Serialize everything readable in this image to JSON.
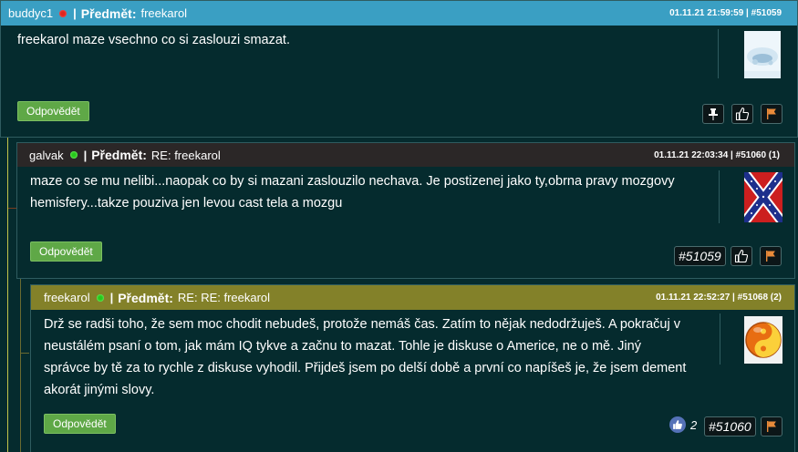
{
  "posts": [
    {
      "author": "buddyc1",
      "status_color": "#e0261e",
      "separator": "|",
      "subject_label": "Předmět:",
      "subject": "freekarol",
      "meta": "01.11.21 21:59:59 | #51059",
      "body": "freekarol maze vsechno co si zaslouzi smazat.",
      "reply_label": "Odpovědět",
      "header_color": "#3a9fc3"
    },
    {
      "author": "galvak",
      "status_color": "#26c91a",
      "separator": "|",
      "subject_label": "Předmět:",
      "subject": "RE: freekarol",
      "meta": "01.11.21 22:03:34 | #51060 (1)",
      "body_lines": [
        "maze co se mu nelibi...naopak co by si mazani zaslouzilo nechava. Je postizenej jako ty,obrna pravy mozgovy",
        "hemisfery...takze pouziva jen levou cast tela a mozgu"
      ],
      "reply_label": "Odpovědět",
      "ref_label": "#51059",
      "header_color": "#2b2727"
    },
    {
      "author": "freekarol",
      "status_color": "#26c91a",
      "separator": "|",
      "subject_label": "Předmět:",
      "subject": "RE: RE: freekarol",
      "meta": "01.11.21 22:52:27 | #51068 (2)",
      "body_lines": [
        "Drž se radši toho, že sem moc chodit nebudeš, protože nemáš čas. Zatím to nějak nedodržuješ. A pokračuj v",
        "neustálém psaní o tom, jak mám IQ tykve a začnu to mazat. Tohle je diskuse o Americe, ne o mě. Jiný",
        "správce by tě za to rychle z diskuse vyhodil. Přijdeš jsem po delší době a první co napíšeš je, že jsem dement",
        "akorát jinými slovy."
      ],
      "reply_label": "Odpovědět",
      "like_count": "2",
      "ref_label": "#51060",
      "header_color": "#838129"
    }
  ]
}
